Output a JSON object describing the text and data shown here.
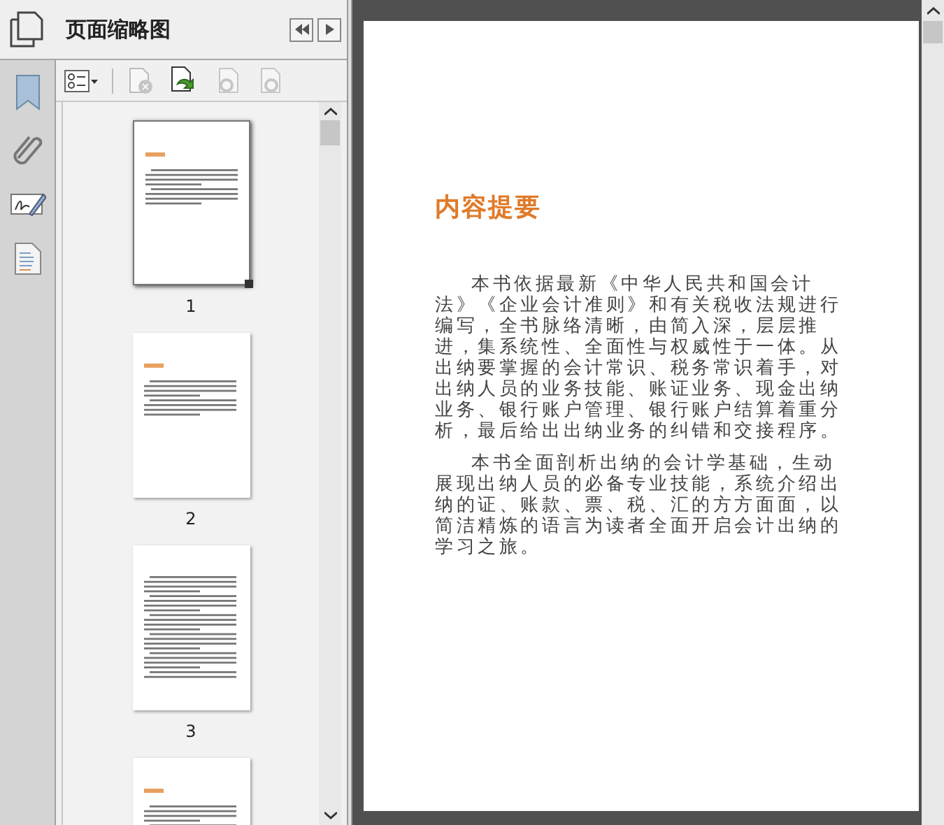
{
  "panel": {
    "title": "页面缩略图"
  },
  "thumbnails": [
    {
      "label": "1",
      "selected": true,
      "kind": "titled"
    },
    {
      "label": "2",
      "selected": false,
      "kind": "titled"
    },
    {
      "label": "3",
      "selected": false,
      "kind": "plain"
    },
    {
      "selected": false,
      "kind": "titled"
    }
  ],
  "page": {
    "heading": "内容提要",
    "paragraphs": [
      "本书依据最新《中华人民共和国会计法》《企业会计准则》和有关税收法规进行编写，全书脉络清晰，由简入深，层层推进，集系统性、全面性与权威性于一体。从出纳要掌握的会计常识、税务常识着手，对出纳人员的业务技能、账证业务、现金出纳业务、银行账户管理、银行账户结算着重分析，最后给出出纳业务的纠错和交接程序。",
      "本书全面剖析出纳的会计学基础，生动展现出纳人员的必备专业技能，系统介绍出纳的证、账款、票、税、汇的方方面面，以简洁精炼的语言为读者全面开启会计出纳的学习之旅。"
    ]
  }
}
